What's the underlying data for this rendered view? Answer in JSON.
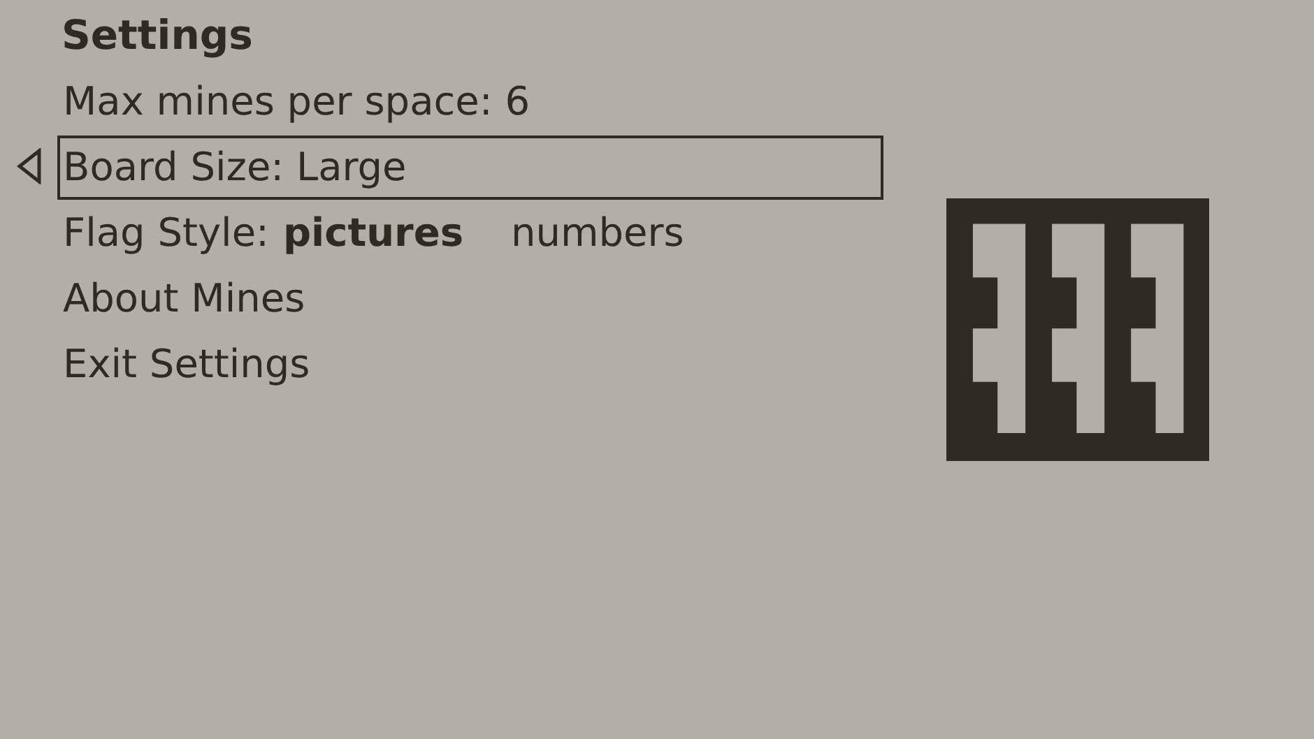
{
  "title": "Settings",
  "items": [
    {
      "kind": "value",
      "label": "Max mines per space: 6",
      "selected": false
    },
    {
      "kind": "value",
      "label": "Board Size: Large",
      "selected": true
    },
    {
      "kind": "choice",
      "label": "Flag Style:",
      "selected": false,
      "options": [
        {
          "label": "pictures",
          "selected": true
        },
        {
          "label": "numbers",
          "selected": false
        }
      ]
    },
    {
      "kind": "value",
      "label": "About Mines",
      "selected": false
    },
    {
      "kind": "value",
      "label": "Exit Settings",
      "selected": false
    }
  ]
}
